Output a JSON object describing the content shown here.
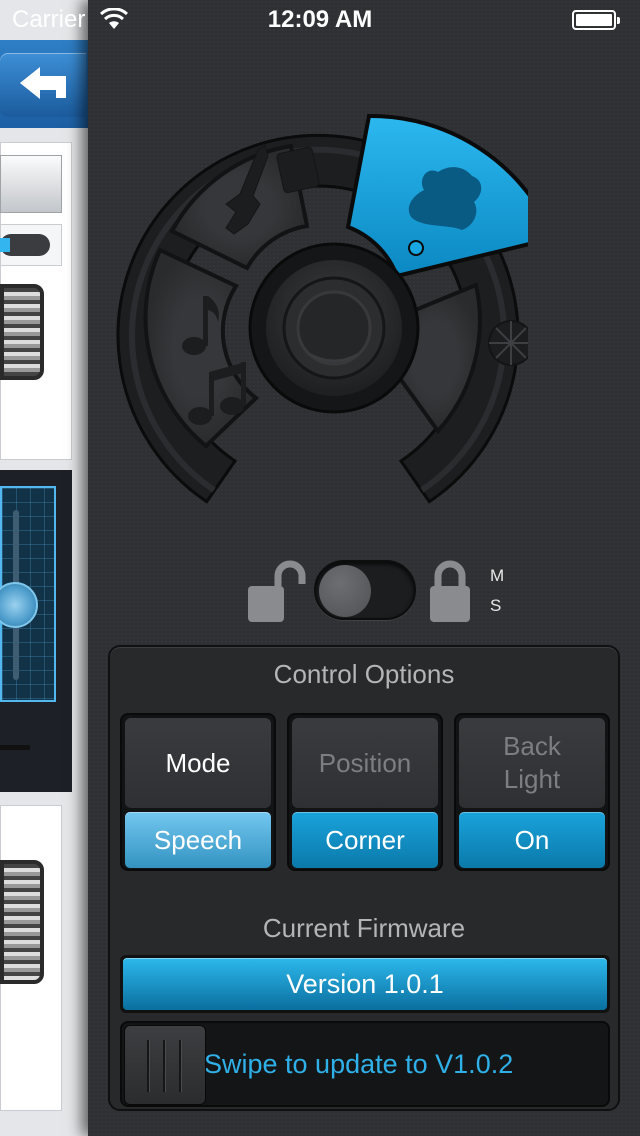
{
  "status_bar": {
    "carrier": "Carrier",
    "time": "12:09 AM"
  },
  "colors": {
    "accent": "#12a5dc",
    "panel_bg": "#2f3033",
    "wheel_segment": "#333436",
    "speech_value_bg": "#55b3df"
  },
  "wheel": {
    "segments": [
      {
        "name": "guitar-icon",
        "selected": false
      },
      {
        "name": "headphones-person-icon",
        "selected": true
      },
      {
        "name": "disco-ball-icon",
        "selected": false
      },
      {
        "name": "music-notes-icon",
        "selected": false
      }
    ]
  },
  "lock": {
    "unlocked_icon": "unlock-icon",
    "locked_icon": "lock-icon",
    "m_label": "M",
    "s_label": "S"
  },
  "control_options": {
    "title": "Control Options",
    "options": [
      {
        "label": "Mode",
        "value": "Speech"
      },
      {
        "label": "Position",
        "value": "Corner"
      },
      {
        "label_line1": "Back",
        "label_line2": "Light",
        "value": "On"
      }
    ]
  },
  "firmware": {
    "title": "Current Firmware",
    "version": "Version 1.0.1",
    "swipe_text": "Swipe to update to V1.0.2"
  }
}
